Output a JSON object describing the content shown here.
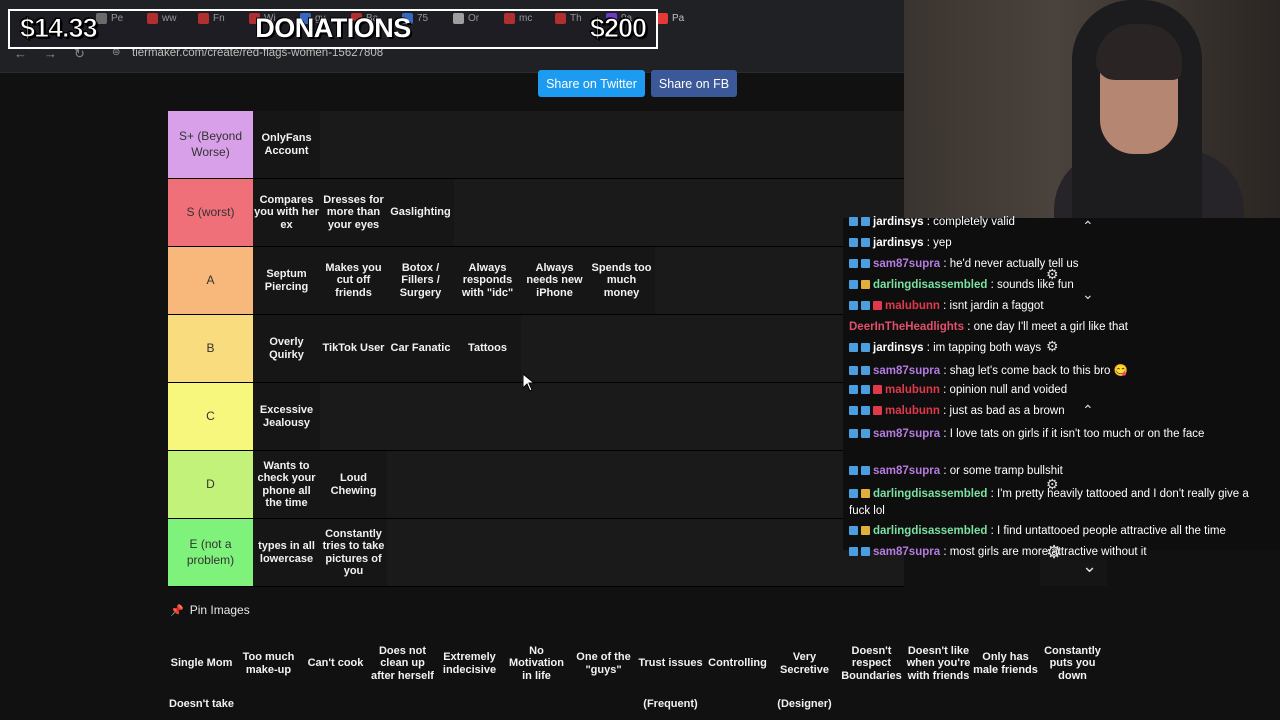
{
  "browser": {
    "url": "tiermaker.com/create/red-flags-women-15627808",
    "tabs": [
      {
        "label": "Pe",
        "color": "#888"
      },
      {
        "label": "ww",
        "color": "#e53935"
      },
      {
        "label": "Fn",
        "color": "#e53935"
      },
      {
        "label": "Wi",
        "color": "#e53935"
      },
      {
        "label": "gy",
        "color": "#4285f4"
      },
      {
        "label": "Ba",
        "color": "#e53935"
      },
      {
        "label": "75",
        "color": "#4285f4"
      },
      {
        "label": "Or",
        "color": "#cccccc"
      },
      {
        "label": "mc",
        "color": "#e53935"
      },
      {
        "label": "Th",
        "color": "#e53935"
      },
      {
        "label": "9a",
        "color": "#9146ff"
      },
      {
        "label": "Pa",
        "color": "#e53935"
      }
    ]
  },
  "donations": {
    "current": "$14.33",
    "title": "DONATIONS",
    "goal": "$200"
  },
  "share": {
    "twitter": "Share on Twitter",
    "fb": "Share on FB"
  },
  "tiers": [
    {
      "label": "S+ (Beyond Worse)",
      "color": "#d9a0ea",
      "items": [
        "OnlyFans Account"
      ]
    },
    {
      "label": "S (worst)",
      "color": "#f0707a",
      "items": [
        "Compares you with her ex",
        "Dresses for more than your eyes",
        "Gaslighting"
      ]
    },
    {
      "label": "A",
      "color": "#f8b87c",
      "items": [
        "Septum Piercing",
        "Makes you cut off friends",
        "Botox / Fillers / Surgery",
        "Always responds with \"idc\"",
        "Always needs new iPhone",
        "Spends too much money"
      ]
    },
    {
      "label": "B",
      "color": "#f9dc7d",
      "items": [
        "Overly Quirky",
        "TikTok User",
        "Car Fanatic",
        "Tattoos"
      ]
    },
    {
      "label": "C",
      "color": "#f7f77d",
      "items": [
        "Excessive Jealousy"
      ]
    },
    {
      "label": "D",
      "color": "#c2f27a",
      "items": [
        "Wants to check your phone all the time",
        "Loud Chewing"
      ]
    },
    {
      "label": "E (not a problem)",
      "color": "#7ef27a",
      "items": [
        "types in all lowercase",
        "Constantly tries to take pictures of you"
      ]
    }
  ],
  "pin_images": "Pin Images",
  "bank": [
    "Single Mom",
    "Too much make-up",
    "Can't cook",
    "Does not clean up after herself",
    "Extremely indecisive",
    "No Motivation in life",
    "One of the \"guys\"",
    "Trust issues",
    "Controlling",
    "Very Secretive",
    "Doesn't respect Boundaries",
    "Doesn't like when you're with friends",
    "Only has male friends",
    "Constantly puts you down"
  ],
  "bank_row2": [
    {
      "text": "Doesn't take",
      "col": 0
    },
    {
      "text": "(Frequent)",
      "col": 7
    },
    {
      "text": "(Designer)",
      "col": 9
    }
  ],
  "chat": [
    {
      "user": "jardinsys",
      "color": "#ffffff",
      "msg": "completely valid",
      "badges": [
        "#4b9fe0",
        "#4b9fe0"
      ]
    },
    {
      "user": "jardinsys",
      "color": "#ffffff",
      "msg": "yep",
      "badges": [
        "#4b9fe0",
        "#4b9fe0"
      ]
    },
    {
      "user": "sam87supra",
      "color": "#b57be0",
      "msg": "he'd never actually tell us",
      "badges": [
        "#4b9fe0",
        "#4b9fe0"
      ]
    },
    {
      "user": "darlingdisassembled",
      "color": "#7be0a0",
      "msg": "sounds like fun",
      "badges": [
        "#4b9fe0",
        "#e0b03a"
      ]
    },
    {
      "user": "malubunn",
      "color": "#e0394b",
      "msg": "isnt jardin a faggot",
      "badges": [
        "#4b9fe0",
        "#4b9fe0",
        "#e0394b"
      ]
    },
    {
      "user": "DeerInTheHeadlights",
      "color": "#e0506a",
      "msg": "one day I'll meet a girl like that",
      "badges": []
    },
    {
      "user": "jardinsys",
      "color": "#ffffff",
      "msg": "im tapping both ways",
      "badges": [
        "#4b9fe0",
        "#4b9fe0"
      ]
    },
    {
      "user": "sam87supra",
      "color": "#b57be0",
      "msg": "shag let's come back to this bro 😋",
      "badges": [
        "#4b9fe0",
        "#4b9fe0"
      ]
    },
    {
      "user": "malubunn",
      "color": "#e0394b",
      "msg": "opinion null and voided",
      "badges": [
        "#4b9fe0",
        "#4b9fe0",
        "#e0394b"
      ]
    },
    {
      "user": "malubunn",
      "color": "#e0394b",
      "msg": "just as bad as a brown",
      "badges": [
        "#4b9fe0",
        "#4b9fe0",
        "#e0394b"
      ]
    },
    {
      "user": "sam87supra",
      "color": "#b57be0",
      "msg": "I love tats on girls if it isn't too much or on the face",
      "badges": [
        "#4b9fe0",
        "#4b9fe0"
      ]
    },
    {
      "user": "sam87supra",
      "color": "#b57be0",
      "msg": "or some tramp bullshit",
      "badges": [
        "#4b9fe0",
        "#4b9fe0"
      ]
    },
    {
      "user": "darlingdisassembled",
      "color": "#7be0a0",
      "msg": "I'm pretty heavily tattooed and I don't really give a fuck lol",
      "badges": [
        "#4b9fe0",
        "#e0b03a"
      ]
    },
    {
      "user": "darlingdisassembled",
      "color": "#7be0a0",
      "msg": "I find untattooed people attractive all the time",
      "badges": [
        "#4b9fe0",
        "#e0b03a"
      ]
    },
    {
      "user": "sam87supra",
      "color": "#b57be0",
      "msg": "most girls are more attractive without it",
      "badges": [
        "#4b9fe0",
        "#4b9fe0"
      ]
    }
  ]
}
